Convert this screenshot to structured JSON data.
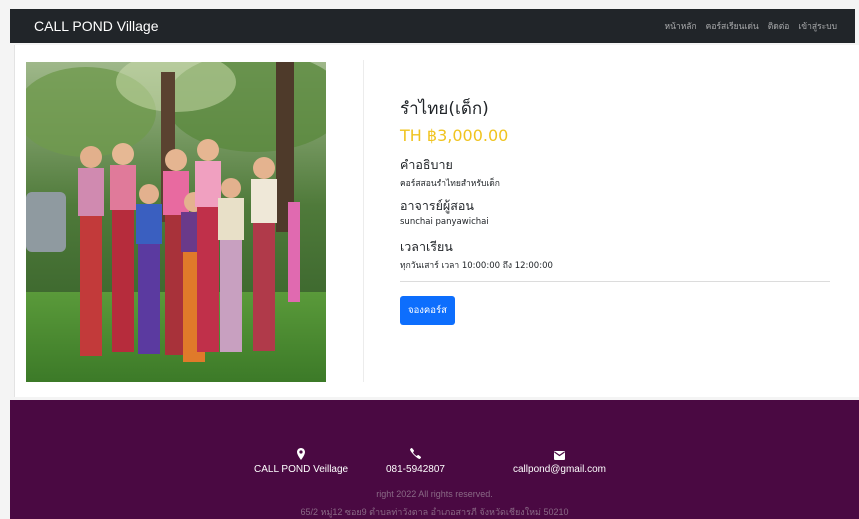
{
  "navbar": {
    "brand": "CALL POND Village",
    "links": [
      "หน้าหลัก",
      "คอร์สเรียนเด่น",
      "ติดต่อ",
      "เข้าสู่ระบบ"
    ]
  },
  "course": {
    "title": "รำไทย(เด็ก)",
    "price": "TH ฿3,000.00",
    "description_label": "คำอธิบาย",
    "description": "คอร์สสอนรำไทยสำหรับเด็ก",
    "teacher_label": "อาจารย์ผู้สอน",
    "teacher": "sunchai panyawichai",
    "schedule_label": "เวลาเรียน",
    "schedule": "ทุกวันเสาร์ เวลา 10:00:00 ถึง 12:00:00",
    "book_label": "จองคอร์ส"
  },
  "footer": {
    "location": "CALL POND Veillage",
    "phone": "081-5942807",
    "email": "callpond@gmail.com",
    "copyright": "right 2022 All rights reserved.",
    "address": "65/2 หมู่12 ซอย9 ตำบลท่าวังตาล อำเภอสารภี จังหวัดเชียงใหม่ 50210"
  },
  "colors": {
    "navbar": "#212529",
    "price": "#f0c420",
    "button": "#0d6efd",
    "footer": "#4a0942"
  },
  "icons": [
    "map-marker-icon",
    "phone-icon",
    "envelope-icon"
  ]
}
